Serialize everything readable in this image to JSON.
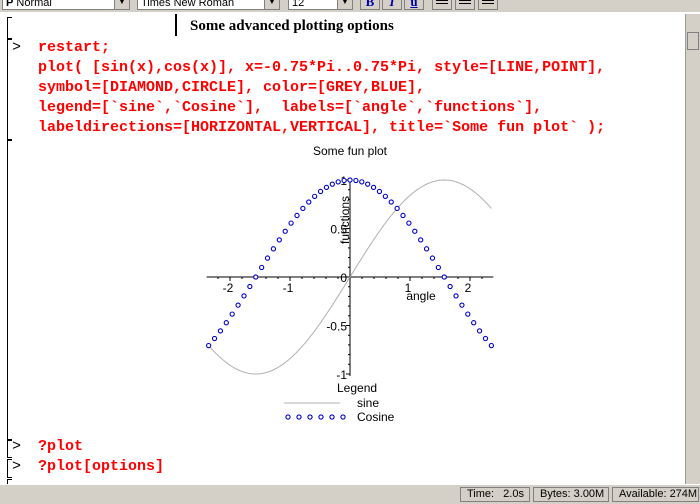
{
  "toolbar": {
    "style_value": "Normal",
    "style_prefix": "P",
    "font_value": "Times New Roman",
    "size_value": "12",
    "bold_label": "B",
    "italic_label": "I",
    "underline_label": "u"
  },
  "section": {
    "title": "Some advanced plotting options"
  },
  "input": {
    "lines": [
      "restart;",
      "plot( [sin(x),cos(x)], x=-0.75*Pi..0.75*Pi, style=[LINE,POINT],",
      "symbol=[DIAMOND,CIRCLE], color=[GREY,BLUE],",
      "legend=[`sine`,`Cosine`],  labels=[`angle`,`functions`],",
      "labeldirections=[HORIZONTAL,VERTICAL], title=`Some fun plot` );"
    ],
    "prompt": ">"
  },
  "chart_data": {
    "type": "line",
    "title": "Some fun plot",
    "xlabel": "angle",
    "ylabel": "functions",
    "xlim": [
      -2.356,
      2.356
    ],
    "ylim": [
      -1,
      1
    ],
    "x_ticks": [
      "-2",
      "-1",
      "1",
      "2"
    ],
    "y_ticks": [
      "1",
      "0.5",
      "0",
      "-0.5",
      "-1"
    ],
    "legend_title": "Legend",
    "series": [
      {
        "name": "sine",
        "style": "line",
        "color": "#b0b0b0",
        "function": "sin"
      },
      {
        "name": "Cosine",
        "style": "point",
        "symbol": "circle",
        "color": "#0000cc",
        "function": "cos"
      }
    ]
  },
  "commands": [
    {
      "prompt": ">",
      "text": "?plot"
    },
    {
      "prompt": ">",
      "text": "?plot[options]"
    }
  ],
  "status": {
    "time_label": "Time:",
    "time_value": "2.0s",
    "bytes_label": "Bytes:",
    "bytes_value": "3.00M",
    "available_label": "Available:",
    "available_value": "274M"
  }
}
